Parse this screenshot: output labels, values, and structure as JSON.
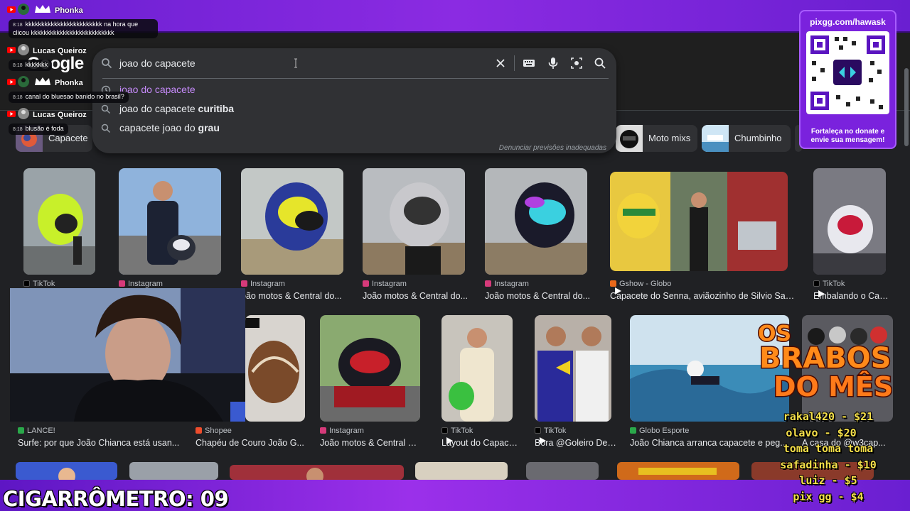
{
  "search": {
    "value": "joao do capacete",
    "brand": "Google",
    "suggestions": [
      {
        "prefix": "joao do capacete",
        "bold": "",
        "visited": true
      },
      {
        "prefix": "joao do capacete ",
        "bold": "curitiba",
        "visited": false
      },
      {
        "prefix": "capacete joao do ",
        "bold": "grau",
        "visited": false
      }
    ],
    "report": "Denunciar previsões inadequadas"
  },
  "chips": [
    {
      "label": "Capacete"
    },
    {
      "label": "Moto mixs"
    },
    {
      "label": "Chumbinho"
    }
  ],
  "results_row1": [
    {
      "source": "TikTok",
      "title": ""
    },
    {
      "source": "Instagram",
      "title": ""
    },
    {
      "source": "Instagram",
      "title": "oão motos & Central do..."
    },
    {
      "source": "Instagram",
      "title": "João motos & Central do..."
    },
    {
      "source": "Instagram",
      "title": "João motos & Central do..."
    },
    {
      "source": "Gshow - Globo",
      "title": "Capacete do Senna, aviãozinho de Silvio Sant..."
    },
    {
      "source": "TikTok",
      "title": "Embalando o Capa..."
    }
  ],
  "results_row2": [
    {
      "source": "LANCE!",
      "title": "Surfe: por que João Chianca está usan..."
    },
    {
      "source": "Shopee",
      "title": "Chapéu de Couro João G..."
    },
    {
      "source": "Instagram",
      "title": "João motos & Central d..."
    },
    {
      "source": "TikTok",
      "title": "Layout do Capacet..."
    },
    {
      "source": "TikTok",
      "title": "Bora @Goleiro De ..."
    },
    {
      "source": "Globo Esporte",
      "title": "João Chianca arranca capacete e peg..."
    },
    {
      "source": "",
      "title": "A casa do @w3cap..."
    }
  ],
  "chat": [
    {
      "name": "Phonka",
      "time": "8:18",
      "message": "kkkkkkkkkkkkkkkkkkkkkkkk na hora que clicou kkkkkkkkkkkkkkkkkkkkkkkkkk"
    },
    {
      "name": "Lucas Queiroz",
      "time": "8:18",
      "message": "kkkkkkk"
    },
    {
      "name": "Phonka",
      "time": "8:18",
      "message": "canal do bluesao banido no brasil?"
    },
    {
      "name": "Lucas Queiroz",
      "time": "8:18",
      "message": "blusão é foda"
    }
  ],
  "qr": {
    "title": "pixgg.com/hawask",
    "caption": "Fortaleça no donate e envie sua mensagem!"
  },
  "leaderboard": {
    "logo_line1": "OS",
    "logo_line2": "BRABOS",
    "logo_line3": "DO MÊS",
    "donors": [
      "rakal420 - $21",
      "olavo - $20",
      "toma toma toma",
      "safadinha - $10",
      "luiz - $5",
      "pix gg - $4"
    ]
  },
  "counter": "CIGARRÔMETRO: 09",
  "colors": {
    "frame": "#8b2be2",
    "page_bg": "#202124",
    "visited": "#c58af9",
    "donor_text": "#f5e04a"
  }
}
